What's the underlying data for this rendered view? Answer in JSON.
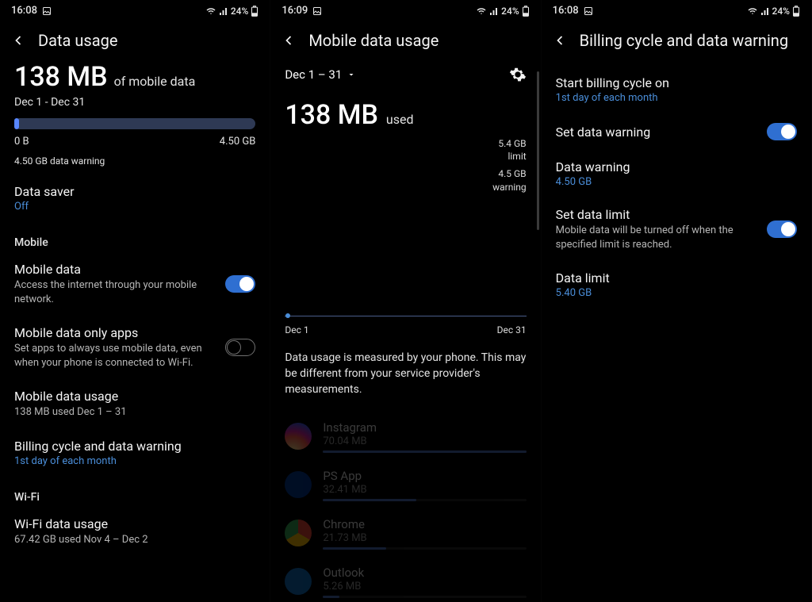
{
  "pane1": {
    "status_time": "16:08",
    "status_battery": "24%",
    "header_title": "Data usage",
    "usage_amount": "138 MB",
    "usage_suffix": "of mobile data",
    "usage_range": "Dec 1 - Dec 31",
    "bar_min": "0 B",
    "bar_max": "4.50 GB",
    "warning_text": "4.50 GB data warning",
    "data_saver": {
      "title": "Data saver",
      "value": "Off"
    },
    "section_mobile": "Mobile",
    "mobile_data": {
      "title": "Mobile data",
      "sub": "Access the internet through your mobile network."
    },
    "mobile_only": {
      "title": "Mobile data only apps",
      "sub": "Set apps to always use mobile data, even when your phone is connected to Wi-Fi."
    },
    "mobile_usage": {
      "title": "Mobile data usage",
      "sub": "138 MB used Dec 1 – 31"
    },
    "billing": {
      "title": "Billing cycle and data warning",
      "sub": "1st day of each month"
    },
    "section_wifi": "Wi-Fi",
    "wifi_usage": {
      "title": "Wi-Fi data usage",
      "sub": "67.42 GB used Nov 4 – Dec 2"
    }
  },
  "pane2": {
    "status_time": "16:09",
    "status_battery": "24%",
    "header_title": "Mobile data usage",
    "range_label": "Dec 1 – 31",
    "usage_amount": "138 MB",
    "used_label": "used",
    "limit_val": "5.4 GB",
    "limit_label": "limit",
    "warning_val": "4.5 GB",
    "warning_label": "warning",
    "chart_start": "Dec 1",
    "chart_end": "Dec 31",
    "note": "Data usage is measured by your phone. This may be different from your service provider's measurements.",
    "apps": [
      {
        "name": "Instagram",
        "mb": "70.04 MB",
        "pct": 100
      },
      {
        "name": "PS App",
        "mb": "32.41 MB",
        "pct": 46
      },
      {
        "name": "Chrome",
        "mb": "21.73 MB",
        "pct": 31
      },
      {
        "name": "Outlook",
        "mb": "5.26 MB",
        "pct": 8
      }
    ]
  },
  "pane3": {
    "status_time": "16:08",
    "status_battery": "24%",
    "header_title": "Billing cycle and data warning",
    "start_cycle": {
      "title": "Start billing cycle on",
      "value": "1st day of each month"
    },
    "set_warning": {
      "title": "Set data warning"
    },
    "data_warning": {
      "title": "Data warning",
      "value": "4.50 GB"
    },
    "set_limit": {
      "title": "Set data limit",
      "sub": "Mobile data will be turned off when the specified limit is reached."
    },
    "data_limit": {
      "title": "Data limit",
      "value": "5.40 GB"
    }
  },
  "chart_data": {
    "type": "line",
    "title": "Mobile data usage",
    "x_start": "Dec 1",
    "x_end": "Dec 31",
    "current_value_mb": 138,
    "limit_gb": 5.4,
    "warning_gb": 4.5,
    "app_breakdown": [
      {
        "name": "Instagram",
        "mb": 70.04
      },
      {
        "name": "PS App",
        "mb": 32.41
      },
      {
        "name": "Chrome",
        "mb": 21.73
      },
      {
        "name": "Outlook",
        "mb": 5.26
      }
    ]
  }
}
